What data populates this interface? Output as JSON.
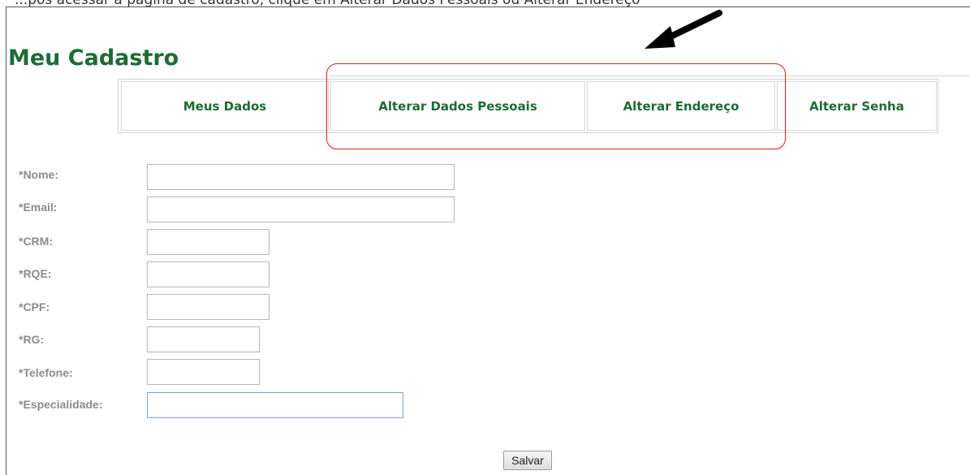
{
  "caption": "...pós acessar a página de cadastro, clique em Alterar Dados Pessoais ou Alterar Endereço",
  "page": {
    "title": "Meu Cadastro"
  },
  "tabs": [
    {
      "label": "Meus Dados"
    },
    {
      "label": "Alterar Dados Pessoais"
    },
    {
      "label": "Alterar Endereço"
    },
    {
      "label": "Alterar Senha"
    }
  ],
  "form": {
    "nome": {
      "label": "*Nome:",
      "value": ""
    },
    "email": {
      "label": "*Email:",
      "value": ""
    },
    "crm": {
      "label": "*CRM:",
      "value": ""
    },
    "rqe": {
      "label": "*RQE:",
      "value": ""
    },
    "cpf": {
      "label": "*CPF:",
      "value": ""
    },
    "rg": {
      "label": "*RG:",
      "value": ""
    },
    "telefone": {
      "label": "*Telefone:",
      "value": ""
    },
    "especialidade": {
      "label": "*Especialidade:",
      "value": ""
    }
  },
  "buttons": {
    "save_label": "Salvar"
  },
  "colors": {
    "accent_green": "#1e6b34",
    "label_gray": "#8c8c8c",
    "highlight_red": "#e0201b",
    "focus_blue": "#7d9fdc",
    "arrow": "#000000"
  },
  "icons": {
    "pointer": "arrow-pointer-icon"
  }
}
